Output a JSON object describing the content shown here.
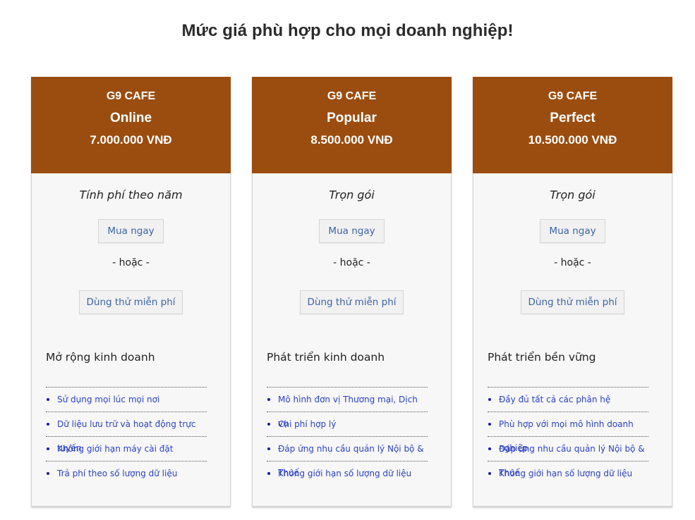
{
  "page": {
    "title": "Mức giá phù hợp cho mọi doanh nghiệp!"
  },
  "colors": {
    "header_bg": "#9b4d0f",
    "link": "#2a3fc6",
    "button_text": "#3d63a8"
  },
  "plans": [
    {
      "brand": "G9 CAFE",
      "name": "Online",
      "price": "7.000.000 VNĐ",
      "billing": "Tính phí theo năm",
      "buy_label": "Mua ngay",
      "or_label": "- hoặc -",
      "trial_label": "Dùng thử miễn phí",
      "feature_title": "Mở rộng kinh doanh",
      "features": [
        "Sử dụng mọi lúc mọi nơi",
        "Dữ liệu lưu trữ và hoạt động trực tuyến",
        "Không giới hạn máy cài đặt",
        "Trả phí theo số lượng dữ liệu"
      ]
    },
    {
      "brand": "G9 CAFE",
      "name": "Popular",
      "price": "8.500.000 VNĐ",
      "billing": "Trọn gói",
      "buy_label": "Mua ngay",
      "or_label": "- hoặc -",
      "trial_label": "Dùng thử miễn phí",
      "feature_title": "Phát triển kinh doanh",
      "features": [
        "Mô hình đơn vị Thương mại, Dịch vụ",
        "Chi phí hợp lý",
        "Đáp ứng nhu cầu quản lý Nội bộ & Thuế",
        "Không giới hạn số lượng dữ liệu"
      ]
    },
    {
      "brand": "G9 CAFE",
      "name": "Perfect",
      "price": "10.500.000 VNĐ",
      "billing": "Trọn gói",
      "buy_label": "Mua ngay",
      "or_label": "- hoặc -",
      "trial_label": "Dùng thử miễn phí",
      "feature_title": "Phát triển bền vững",
      "features": [
        "Đầy đủ tất cả các phân hệ",
        "Phù hợp với mọi mô hình doanh nghiệp",
        "Đáp ứng nhu cầu quản lý Nội bộ & Thuế",
        "Không giới hạn số lượng dữ liệu"
      ]
    }
  ]
}
